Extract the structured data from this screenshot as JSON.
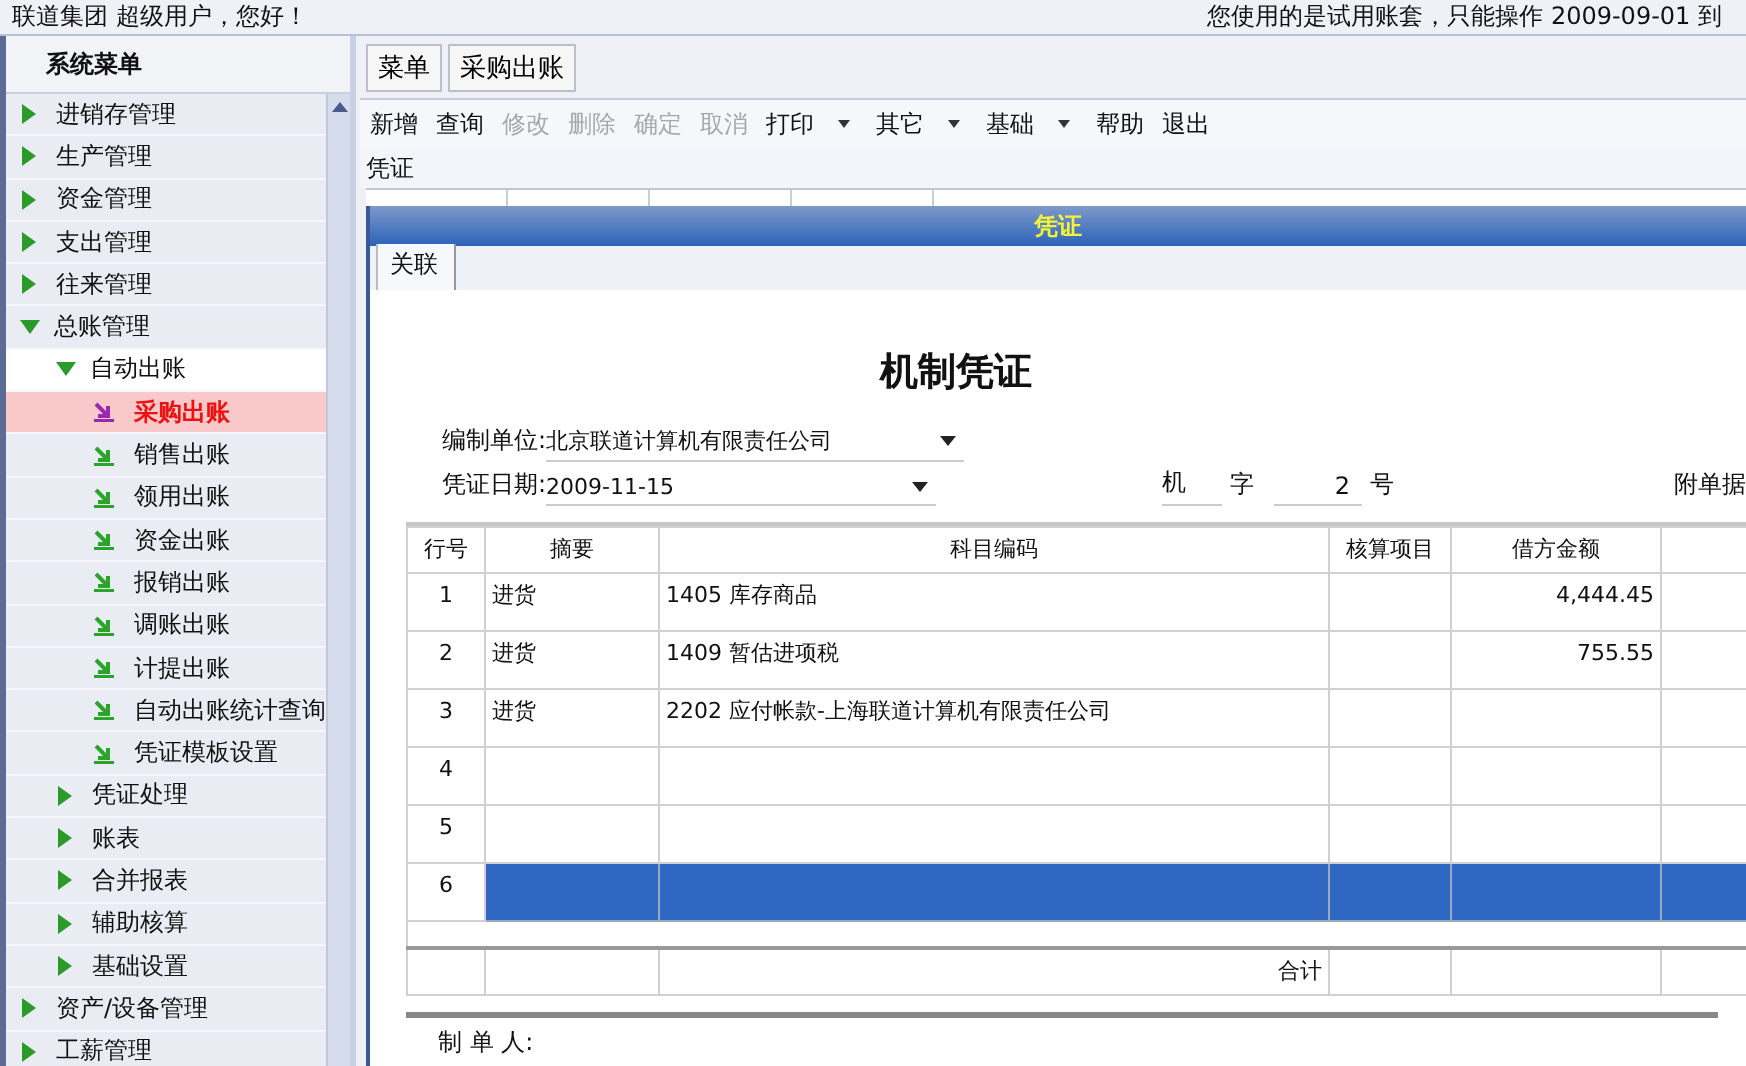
{
  "header": {
    "greeting": "联道集团 超级用户，您好！",
    "notice": "您使用的是试用账套，只能操作 2009-09-01 到"
  },
  "sidebar": {
    "title": "系统菜单",
    "items": [
      {
        "kind": "group",
        "label": "进销存管理",
        "expanded": false
      },
      {
        "kind": "group",
        "label": "生产管理",
        "expanded": false
      },
      {
        "kind": "group",
        "label": "资金管理",
        "expanded": false
      },
      {
        "kind": "group",
        "label": "支出管理",
        "expanded": false
      },
      {
        "kind": "group",
        "label": "往来管理",
        "expanded": false
      },
      {
        "kind": "group",
        "label": "总账管理",
        "expanded": true,
        "children": [
          {
            "kind": "group",
            "label": "自动出账",
            "expanded": true,
            "children": [
              {
                "kind": "entry",
                "label": "采购出账",
                "selected": true
              },
              {
                "kind": "entry",
                "label": "销售出账",
                "selected": false
              },
              {
                "kind": "entry",
                "label": "领用出账",
                "selected": false
              },
              {
                "kind": "entry",
                "label": "资金出账",
                "selected": false
              },
              {
                "kind": "entry",
                "label": "报销出账",
                "selected": false
              },
              {
                "kind": "entry",
                "label": "调账出账",
                "selected": false
              },
              {
                "kind": "entry",
                "label": "计提出账",
                "selected": false
              },
              {
                "kind": "entry",
                "label": "自动出账统计查询",
                "selected": false
              },
              {
                "kind": "entry",
                "label": "凭证模板设置",
                "selected": false
              }
            ]
          },
          {
            "kind": "group",
            "label": "凭证处理",
            "expanded": false
          },
          {
            "kind": "group",
            "label": "账表",
            "expanded": false
          },
          {
            "kind": "group",
            "label": "合并报表",
            "expanded": false
          },
          {
            "kind": "group",
            "label": "辅助核算",
            "expanded": false
          },
          {
            "kind": "group",
            "label": "基础设置",
            "expanded": false
          }
        ]
      },
      {
        "kind": "group",
        "label": "资产/设备管理",
        "expanded": false
      },
      {
        "kind": "group",
        "label": "工薪管理",
        "expanded": false
      }
    ]
  },
  "tabs": [
    "菜单",
    "采购出账"
  ],
  "toolbar": [
    {
      "label": "新增",
      "disabled": false,
      "dropdown": false
    },
    {
      "label": "查询",
      "disabled": false,
      "dropdown": false
    },
    {
      "label": "修改",
      "disabled": true,
      "dropdown": false
    },
    {
      "label": "删除",
      "disabled": true,
      "dropdown": false
    },
    {
      "label": "确定",
      "disabled": true,
      "dropdown": false
    },
    {
      "label": "取消",
      "disabled": true,
      "dropdown": false
    },
    {
      "label": "打印",
      "disabled": false,
      "dropdown": true
    },
    {
      "label": "其它",
      "disabled": false,
      "dropdown": true
    },
    {
      "label": "基础",
      "disabled": false,
      "dropdown": true
    },
    {
      "label": "帮助",
      "disabled": false,
      "dropdown": false
    },
    {
      "label": "退出",
      "disabled": false,
      "dropdown": false
    }
  ],
  "section_label": "凭证",
  "voucher": {
    "window_title": "凭证",
    "tab": "关联",
    "title": "机制凭证",
    "fields": [
      {
        "label": "编制单位:",
        "value": "北京联道计算机有限责任公司"
      },
      {
        "label": "凭证日期:",
        "value": "2009-11-15"
      }
    ],
    "type_value": "机",
    "type_label": "字",
    "number": "2",
    "number_label": "号",
    "attachments_label": "附单据",
    "columns": [
      "行号",
      "摘要",
      "科目编码",
      "核算项目",
      "借方金额"
    ],
    "rows": [
      {
        "line": "1",
        "summary": "进货",
        "account": "1405 库存商品",
        "debit": "4,444.45",
        "selected": false
      },
      {
        "line": "2",
        "summary": "进货",
        "account": "1409 暂估进项税",
        "debit": "755.55",
        "selected": false
      },
      {
        "line": "3",
        "summary": "进货",
        "account": "2202 应付帐款-上海联道计算机有限责任公司",
        "debit": "",
        "selected": false
      },
      {
        "line": "4",
        "summary": "",
        "account": "",
        "debit": "",
        "selected": false
      },
      {
        "line": "5",
        "summary": "",
        "account": "",
        "debit": "",
        "selected": false
      },
      {
        "line": "6",
        "summary": "",
        "account": "",
        "debit": "",
        "selected": true
      }
    ],
    "total_label": "合计",
    "preparer_label": "制 单 人:"
  }
}
